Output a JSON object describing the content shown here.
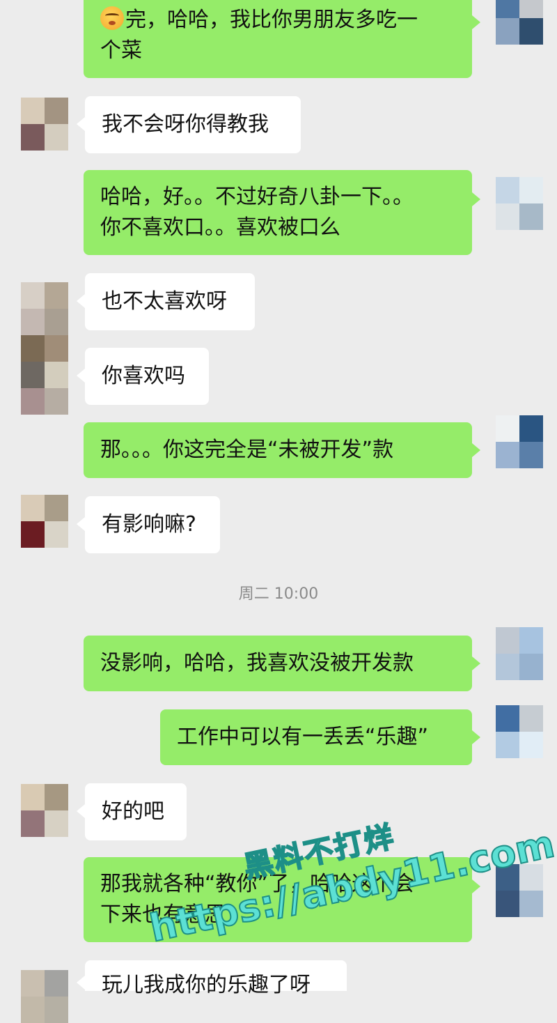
{
  "messages": [
    {
      "side": "me",
      "emoji": "tired-face",
      "text": "完，哈哈，我比你男朋友多吃一\n个菜"
    },
    {
      "side": "them",
      "text": "我不会呀你得教我"
    },
    {
      "side": "me",
      "text": "哈哈，好。。不过好奇八卦一下。。\n你不喜欢口。。喜欢被口么"
    },
    {
      "side": "them",
      "text": "也不太喜欢呀"
    },
    {
      "side": "them",
      "text": "你喜欢吗"
    },
    {
      "side": "me",
      "text": "那。。。你这完全是“未被开发”款"
    },
    {
      "side": "them",
      "text": "有影响嘛?"
    },
    {
      "side": "me",
      "text": "没影响，哈哈，我喜欢没被开发款"
    },
    {
      "side": "me",
      "text": "工作中可以有一丢丢“乐趣”"
    },
    {
      "side": "them",
      "text": "好的吧"
    },
    {
      "side": "me",
      "text": "那我就各种“教你”了，哈哈这个会\n下来也有意思"
    },
    {
      "side": "them",
      "text": "玩儿我成你的乐趣了呀"
    }
  ],
  "timestamp": "周二 10:00",
  "watermark": {
    "line1": "黑料不打烊",
    "line2": "https://abdy11.com"
  },
  "colors": {
    "background": "#ececec",
    "my_bubble": "#95ec69",
    "their_bubble": "#ffffff",
    "timestamp": "#8a8a8a"
  }
}
